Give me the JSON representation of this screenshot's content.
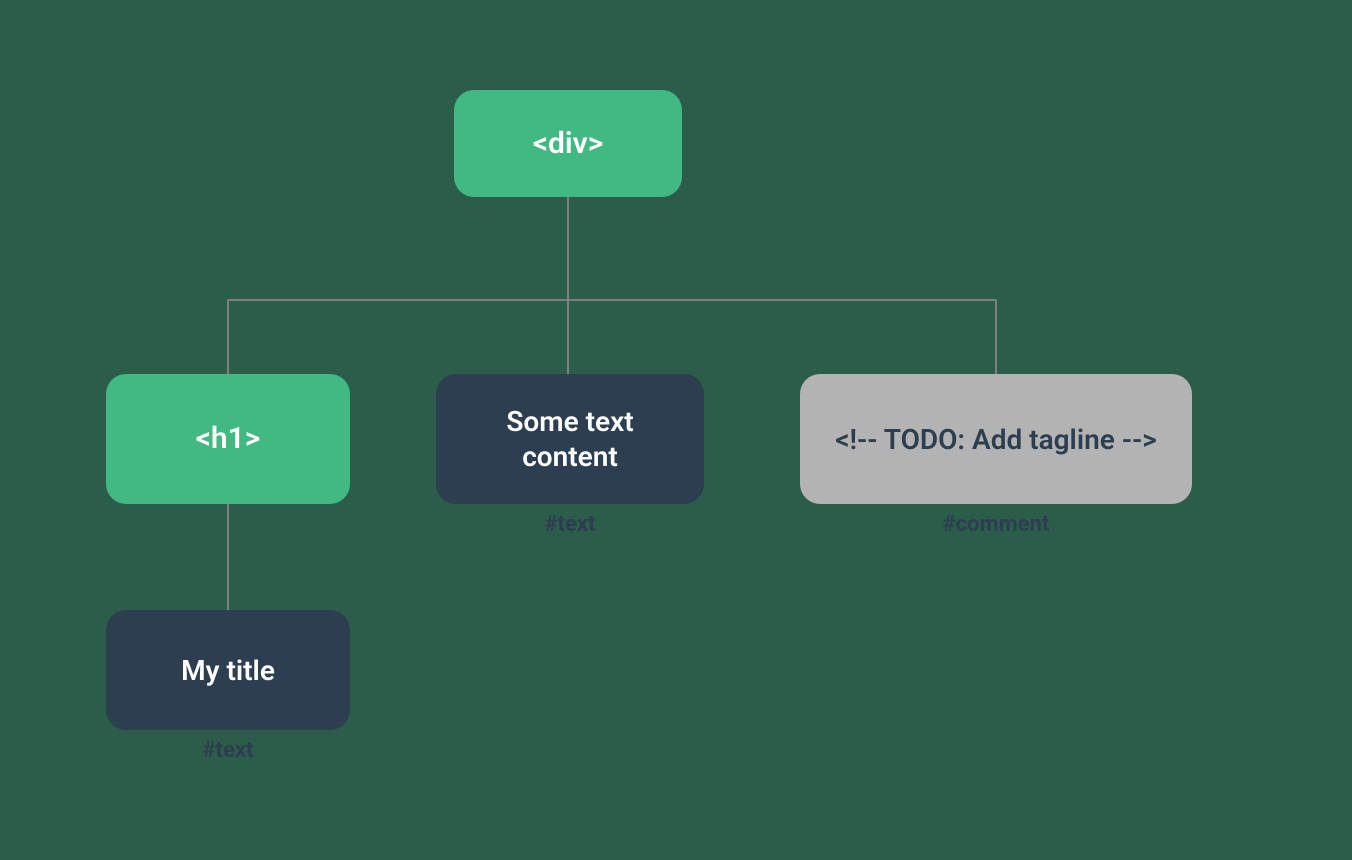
{
  "nodes": {
    "root": {
      "label": "<div>"
    },
    "h1": {
      "label": "<h1>"
    },
    "text": {
      "label": "Some text content",
      "note": "#text"
    },
    "comment": {
      "label": "<!-- TODO: Add tagline  -->",
      "note": "#comment"
    },
    "title": {
      "label": "My title",
      "note": "#text"
    }
  },
  "colors": {
    "background": "#2b5d4a",
    "element": "#42b883",
    "textnode": "#2c3e50",
    "commentnode": "#b3b3b3",
    "connector": "#808080"
  }
}
